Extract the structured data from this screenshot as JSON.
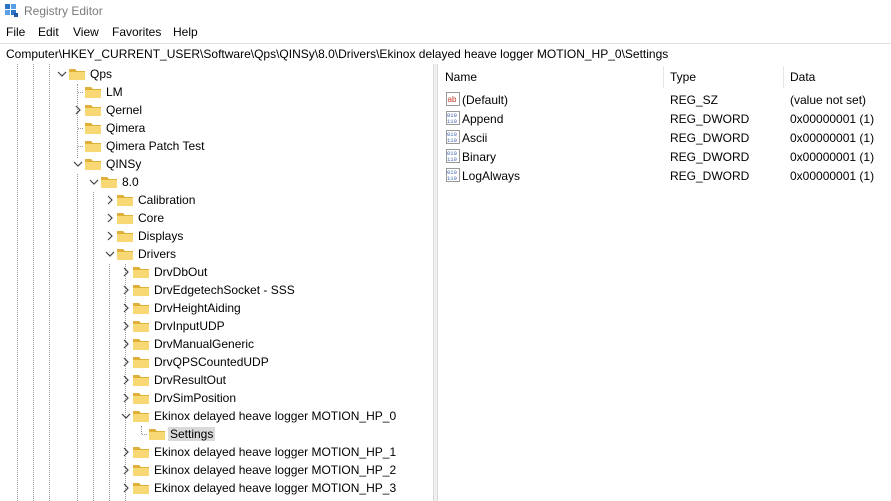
{
  "window": {
    "title": "Registry Editor",
    "icon": "registry-editor-icon"
  },
  "menu": [
    "File",
    "Edit",
    "View",
    "Favorites",
    "Help"
  ],
  "address": "Computer\\HKEY_CURRENT_USER\\Software\\Qps\\QINSy\\8.0\\Drivers\\Ekinox delayed heave logger MOTION_HP_0\\Settings",
  "tree": [
    {
      "label": "Qps",
      "state": "expanded"
    },
    {
      "label": "LM",
      "state": "leaf"
    },
    {
      "label": "Qernel",
      "state": "collapsed"
    },
    {
      "label": "Qimera",
      "state": "leaf"
    },
    {
      "label": "Qimera Patch Test",
      "state": "leaf"
    },
    {
      "label": "QINSy",
      "state": "expanded"
    },
    {
      "label": "8.0",
      "state": "expanded"
    },
    {
      "label": "Calibration",
      "state": "collapsed"
    },
    {
      "label": "Core",
      "state": "collapsed"
    },
    {
      "label": "Displays",
      "state": "collapsed"
    },
    {
      "label": "Drivers",
      "state": "expanded"
    },
    {
      "label": "DrvDbOut",
      "state": "collapsed"
    },
    {
      "label": "DrvEdgetechSocket - SSS",
      "state": "collapsed"
    },
    {
      "label": "DrvHeightAiding",
      "state": "collapsed"
    },
    {
      "label": "DrvInputUDP",
      "state": "collapsed"
    },
    {
      "label": "DrvManualGeneric",
      "state": "collapsed"
    },
    {
      "label": "DrvQPSCountedUDP",
      "state": "collapsed"
    },
    {
      "label": "DrvResultOut",
      "state": "collapsed"
    },
    {
      "label": "DrvSimPosition",
      "state": "collapsed"
    },
    {
      "label": "Ekinox delayed heave logger MOTION_HP_0",
      "state": "expanded"
    },
    {
      "label": "Settings",
      "state": "leaf",
      "selected": true
    },
    {
      "label": "Ekinox delayed heave logger MOTION_HP_1",
      "state": "collapsed"
    },
    {
      "label": "Ekinox delayed heave logger MOTION_HP_2",
      "state": "collapsed"
    },
    {
      "label": "Ekinox delayed heave logger MOTION_HP_3",
      "state": "collapsed"
    }
  ],
  "columns": {
    "name": "Name",
    "type": "Type",
    "data": "Data"
  },
  "values": [
    {
      "icon": "string-value-icon",
      "name": "(Default)",
      "type": "REG_SZ",
      "data": "(value not set)"
    },
    {
      "icon": "binary-value-icon",
      "name": "Append",
      "type": "REG_DWORD",
      "data": "0x00000001 (1)"
    },
    {
      "icon": "binary-value-icon",
      "name": "Ascii",
      "type": "REG_DWORD",
      "data": "0x00000001 (1)"
    },
    {
      "icon": "binary-value-icon",
      "name": "Binary",
      "type": "REG_DWORD",
      "data": "0x00000001 (1)"
    },
    {
      "icon": "binary-value-icon",
      "name": "LogAlways",
      "type": "REG_DWORD",
      "data": "0x00000001 (1)"
    }
  ],
  "colors": {
    "folder": "#f8d775",
    "folder_dark": "#e0b138",
    "selection": "#d9d9d9",
    "dword_icon": "#3b63b3",
    "sz_icon": "#c0392b"
  }
}
